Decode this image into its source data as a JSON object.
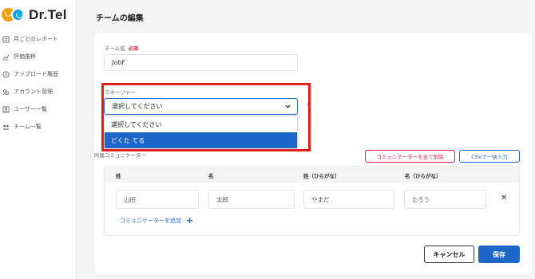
{
  "app": {
    "logo_text": "Dr.Tel"
  },
  "sidebar": {
    "items": [
      {
        "label": "月ごとのレポート",
        "icon": "report-icon"
      },
      {
        "label": "評価推移",
        "icon": "trend-icon"
      },
      {
        "label": "アップロード履歴",
        "icon": "clock-icon"
      },
      {
        "label": "アカウント管理",
        "icon": "account-icon"
      },
      {
        "label": "ユーザー一覧",
        "icon": "user-icon"
      },
      {
        "label": "チーム一覧",
        "icon": "team-icon"
      }
    ]
  },
  "page": {
    "title": "チームの編集"
  },
  "form": {
    "team_name_label": "チーム名",
    "required_badge": "必須",
    "team_name_value": "JobF",
    "manager_label": "マネージャー",
    "manager_select_value": "選択してください",
    "manager_options": [
      "選択してください",
      "どくた てる"
    ],
    "manager_selected_index": 1,
    "communicators_label": "所属コミュニケーター",
    "remove_all_button": "コミュニケーターを全て削除",
    "csv_import_button": "CSVで一括入力",
    "table_headers": [
      "姓",
      "名",
      "姓（ひらがな）",
      "名（ひらがな）"
    ],
    "rows": [
      {
        "last_name": "山田",
        "first_name": "太郎",
        "last_kana": "やまだ",
        "first_kana": "たろう"
      }
    ],
    "add_communicator_link": "コミュニケーターを追加",
    "cancel_button": "キャンセル",
    "save_button": "保存"
  },
  "colors": {
    "accent": "#1e66c9",
    "danger": "#e11d48",
    "highlight": "#e11d1d"
  }
}
